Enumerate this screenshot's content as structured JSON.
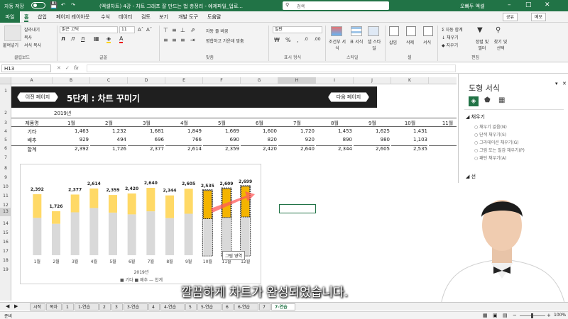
{
  "titlebar": {
    "autosave": "자동 저장",
    "autosave_state": "끔",
    "title": "(엑셀차트) 4강 - 차트 그래프 잘 만드는 법 총정리 - 예제파일_업로...",
    "search": "검색",
    "user": "오빠두 엑셀"
  },
  "menu": {
    "file": "파일",
    "tabs": [
      "홈",
      "삽입",
      "페이지 레이아웃",
      "수식",
      "데이터",
      "검토",
      "보기",
      "개발 도구",
      "도움말"
    ],
    "share": "공유",
    "comment": "메모"
  },
  "ribbon": {
    "clipboard": {
      "paste": "붙여넣기",
      "cut": "잘라내기",
      "copy": "복사",
      "format_painter": "서식 복사",
      "label": "클립보드"
    },
    "font": {
      "name": "맑은 고딕",
      "size": "11",
      "label": "글꼴"
    },
    "align": {
      "wrap": "자동 줄 바꿈",
      "merge": "병합하고 가운데 맞춤",
      "label": "맞춤"
    },
    "number": {
      "format": "일반",
      "label": "표시 형식"
    },
    "styles": {
      "cond": "조건부 서식",
      "table": "표 서식",
      "cell": "셀 스타일",
      "label": "스타일"
    },
    "cells": {
      "insert": "삽입",
      "delete": "삭제",
      "format": "서식",
      "label": "셀"
    },
    "edit": {
      "autosum": "자동 합계",
      "fill": "채우기",
      "clear": "지우기",
      "sort": "정렬 및 필터",
      "find": "찾기 및 선택",
      "label": "편집"
    }
  },
  "formula": {
    "namebox": "H13",
    "fx": "fx"
  },
  "columns": [
    "A",
    "B",
    "C",
    "D",
    "E",
    "F",
    "G",
    "H",
    "I",
    "J",
    "K"
  ],
  "rows": [
    "1",
    "2",
    "3",
    "4",
    "5",
    "6",
    "7",
    "8",
    "9",
    "10",
    "11",
    "12",
    "13",
    "14",
    "15",
    "16",
    "17",
    "18",
    "19"
  ],
  "banner": {
    "prev": "이전 페이지",
    "title": "5단계 : 차트 꾸미기",
    "next": "다음 페이지"
  },
  "table": {
    "year": "2019년",
    "headers": [
      "제품명",
      "1월",
      "2월",
      "3월",
      "4월",
      "5월",
      "6월",
      "7월",
      "8월",
      "9월",
      "10월",
      "11월"
    ],
    "rows": [
      [
        "기타",
        "1,463",
        "1,232",
        "1,681",
        "1,849",
        "1,669",
        "1,600",
        "1,720",
        "1,453",
        "1,625",
        "1,431",
        "1"
      ],
      [
        "배추",
        "929",
        "494",
        "696",
        "766",
        "690",
        "820",
        "920",
        "890",
        "980",
        "1,103",
        "1"
      ],
      [
        "합계",
        "2,392",
        "1,726",
        "2,377",
        "2,614",
        "2,359",
        "2,420",
        "2,640",
        "2,344",
        "2,605",
        "2,535",
        "2"
      ]
    ]
  },
  "chart_data": {
    "type": "bar",
    "categories": [
      "1월",
      "2월",
      "3월",
      "4월",
      "5월",
      "6월",
      "7월",
      "8월",
      "9월",
      "10월",
      "11월",
      "12월"
    ],
    "series": [
      {
        "name": "기타",
        "values": [
          1463,
          1232,
          1681,
          1849,
          1669,
          1600,
          1720,
          1453,
          1625,
          1431,
          1480,
          1500
        ]
      },
      {
        "name": "배추",
        "values": [
          929,
          494,
          696,
          766,
          690,
          820,
          920,
          890,
          980,
          1103,
          1129,
          1199
        ]
      }
    ],
    "totals": [
      2392,
      1726,
      2377,
      2614,
      2359,
      2420,
      2640,
      2344,
      2605,
      2535,
      2609,
      2699
    ],
    "total_labels": [
      "2,392",
      "1,726",
      "2,377",
      "2,614",
      "2,359",
      "2,420",
      "2,640",
      "2,344",
      "2,605",
      "2,535",
      "2,609",
      "2,699"
    ],
    "xlabel": "2019년",
    "legend": [
      "기타",
      "배추",
      "합계"
    ],
    "legend_position": "bottom",
    "colors": {
      "기타": "#d9d9d9",
      "배추": "#ffd966",
      "highlight": "#f4b400"
    }
  },
  "chart_tooltip": "그림 영역",
  "panel": {
    "title": "도형 서식",
    "fill_section": "채우기",
    "fill_options": [
      "채우기 없음(N)",
      "단색 채우기(S)",
      "그라데이션 채우기(G)",
      "그림 또는 질감 채우기(P)",
      "패턴 채우기(A)"
    ],
    "line_section": "선"
  },
  "subtitle": "깔끔하게 차트가 완성되었습니다.",
  "sheets": [
    "시작",
    "목차",
    "1",
    "1-연습",
    "2",
    "3",
    "3-연습",
    "4",
    "4-연습",
    "5",
    "5-연습",
    "6",
    "6-연습",
    "7",
    "7-연습"
  ],
  "status": {
    "mode": "준비",
    "zoom": "100%"
  },
  "colors": {
    "excel_green": "#217346",
    "banner_bg": "#1f1f1f"
  }
}
